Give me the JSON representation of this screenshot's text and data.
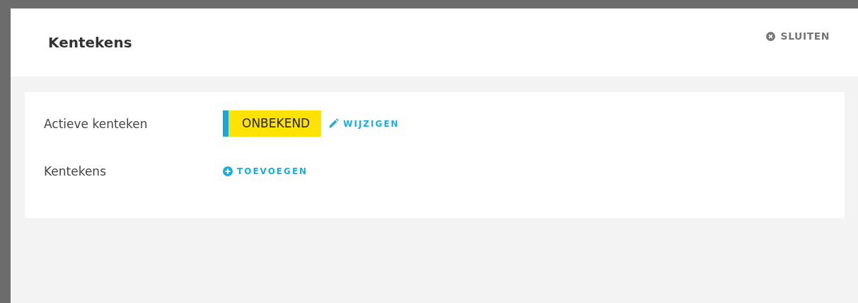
{
  "dialog": {
    "title": "Kentekens",
    "close_label": "SLUITEN"
  },
  "fields": [
    {
      "label": "Actieve kenteken",
      "kind": "plate",
      "plate": "ONBEKEND",
      "action": "WIJZIGEN"
    },
    {
      "label": "Kentekens",
      "kind": "add",
      "action": "TOEVOEGEN"
    }
  ]
}
